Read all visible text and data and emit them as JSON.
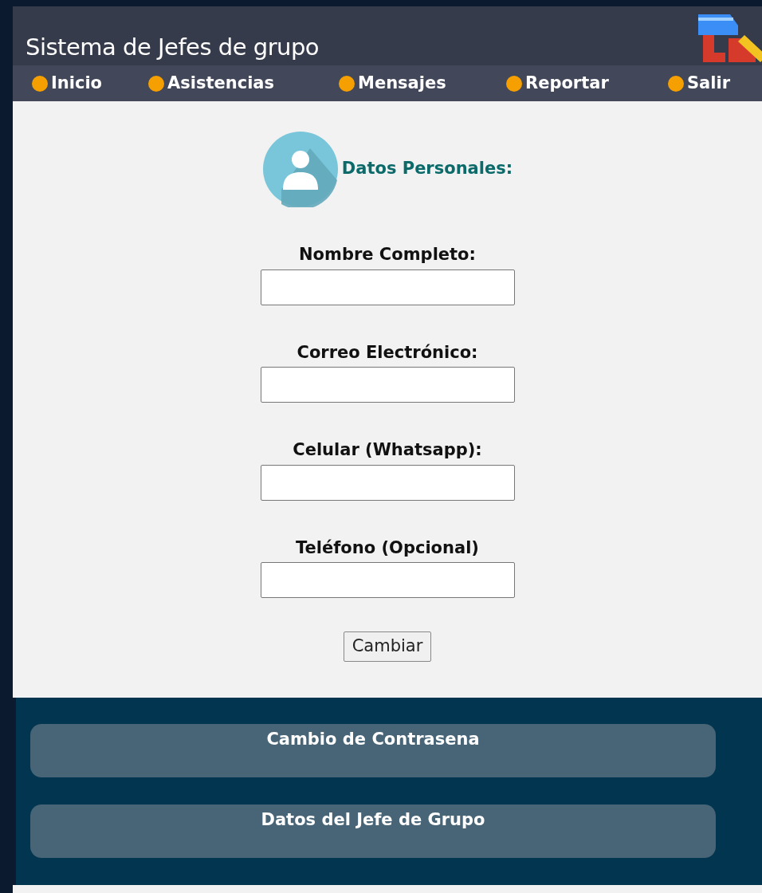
{
  "header": {
    "title": "Sistema de Jefes de grupo"
  },
  "nav": [
    {
      "label": "Inicio"
    },
    {
      "label": "Asistencias"
    },
    {
      "label": "Mensajes"
    },
    {
      "label": "Reportar"
    },
    {
      "label": "Salir"
    }
  ],
  "section": {
    "title": "Datos Personales:"
  },
  "fields": [
    {
      "label": "Nombre Completo:"
    },
    {
      "label": "Correo Electrónico:"
    },
    {
      "label": "Celular (Whatsapp):"
    },
    {
      "label": "Teléfono (Opcional)"
    }
  ],
  "submit": "Cambiar",
  "menu": [
    {
      "label": "Cambio de Contrasena"
    },
    {
      "label": "Datos del Jefe de Grupo"
    }
  ]
}
